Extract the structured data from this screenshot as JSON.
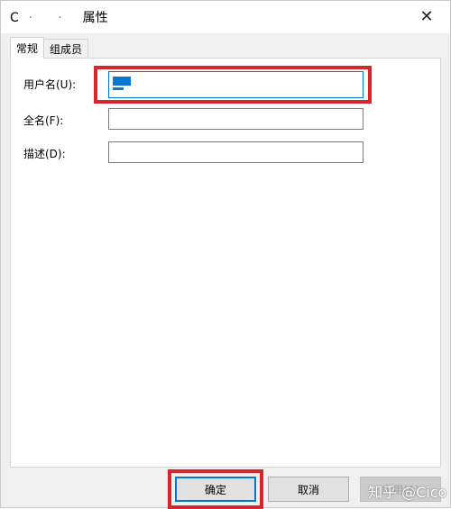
{
  "window": {
    "title_prefix": "C",
    "title_suffix": "属性",
    "close_glyph": "✕"
  },
  "tabs": [
    {
      "label": "常规",
      "active": true
    },
    {
      "label": "组成员",
      "active": false
    }
  ],
  "fields": {
    "username": {
      "label": "用户名(U):",
      "value": ""
    },
    "fullname": {
      "label": "全名(F):",
      "value": ""
    },
    "description": {
      "label": "描述(D):",
      "value": ""
    }
  },
  "buttons": {
    "ok": "确定",
    "cancel": "取消",
    "apply": "应用(A)"
  },
  "watermark": "知乎 @Cico",
  "colors": {
    "annotation_red": "#d9262c",
    "focus_blue": "#0078d7",
    "selection_blue": "#0b78d0"
  }
}
